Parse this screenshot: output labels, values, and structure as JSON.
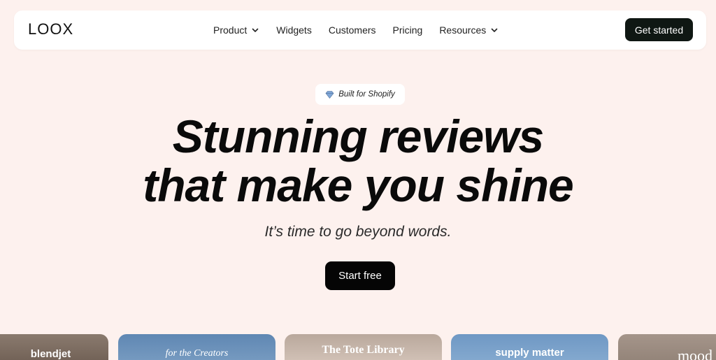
{
  "nav": {
    "logo": "LOOX",
    "links": [
      {
        "label": "Product",
        "has_dropdown": true
      },
      {
        "label": "Widgets",
        "has_dropdown": false
      },
      {
        "label": "Customers",
        "has_dropdown": false
      },
      {
        "label": "Pricing",
        "has_dropdown": false
      },
      {
        "label": "Resources",
        "has_dropdown": true
      }
    ],
    "cta_label": "Get started"
  },
  "hero": {
    "badge_icon": "diamond-icon",
    "badge_text": "Built for Shopify",
    "headline_line1": "Stunning reviews",
    "headline_line2": "that make you shine",
    "subheadline": "It’s time to go beyond words.",
    "cta_label": "Start free"
  },
  "cards": [
    {
      "label": "blendjet"
    },
    {
      "label": "for the Creators"
    },
    {
      "label": "The Tote Library"
    },
    {
      "label": "supply matter"
    },
    {
      "label": "mood"
    }
  ],
  "colors": {
    "background": "#fdf1ee",
    "button_dark": "#0f1713",
    "start_button": "#050505"
  }
}
